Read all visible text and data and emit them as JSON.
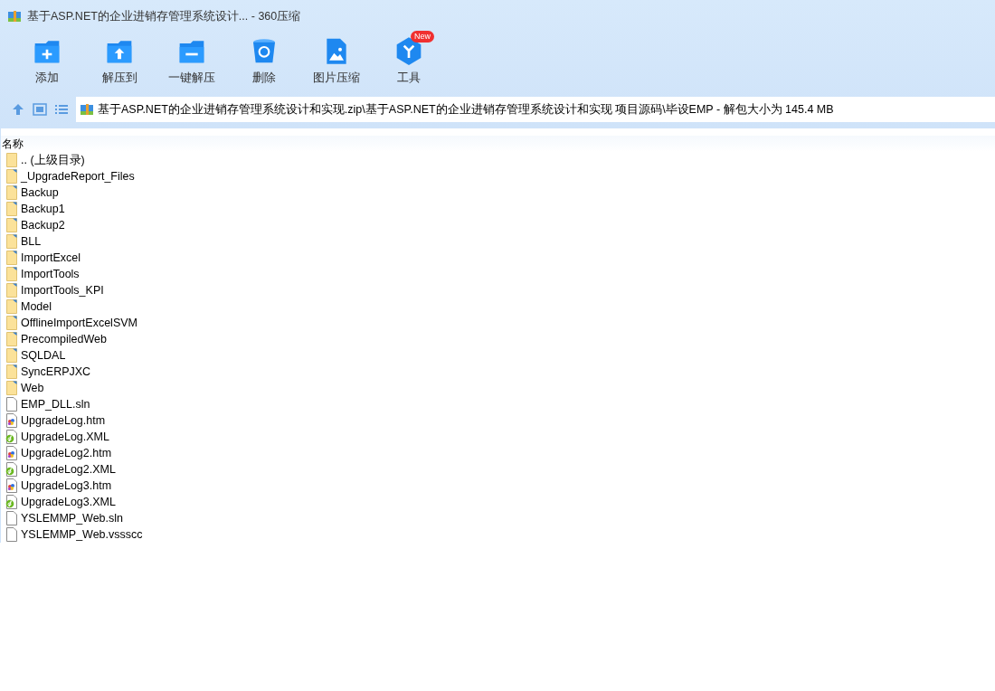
{
  "window": {
    "title": "基于ASP.NET的企业进销存管理系统设计... - 360压缩"
  },
  "toolbar": [
    {
      "kind": "add",
      "label": "添加"
    },
    {
      "kind": "extract-to",
      "label": "解压到"
    },
    {
      "kind": "extract",
      "label": "一键解压"
    },
    {
      "kind": "delete",
      "label": "删除"
    },
    {
      "kind": "image",
      "label": "图片压缩"
    },
    {
      "kind": "tools",
      "label": "工具",
      "badge": "New"
    }
  ],
  "address": {
    "path": "基于ASP.NET的企业进销存管理系统设计和实现.zip\\基于ASP.NET的企业进销存管理系统设计和实现 项目源码\\毕设EMP - 解包大小为 145.4 MB"
  },
  "table": {
    "columns": [
      "名称"
    ],
    "rows": [
      {
        "kind": "parent",
        "name": ".. (上级目录)"
      },
      {
        "kind": "folder",
        "name": "_UpgradeReport_Files"
      },
      {
        "kind": "folder",
        "name": "Backup"
      },
      {
        "kind": "folder",
        "name": "Backup1"
      },
      {
        "kind": "folder",
        "name": "Backup2"
      },
      {
        "kind": "folder",
        "name": "BLL"
      },
      {
        "kind": "folder",
        "name": "ImportExcel"
      },
      {
        "kind": "folder",
        "name": "ImportTools"
      },
      {
        "kind": "folder",
        "name": "ImportTools_KPI"
      },
      {
        "kind": "folder",
        "name": "Model"
      },
      {
        "kind": "folder",
        "name": "OfflineImportExcelSVM"
      },
      {
        "kind": "folder",
        "name": "PrecompiledWeb"
      },
      {
        "kind": "folder",
        "name": "SQLDAL"
      },
      {
        "kind": "folder",
        "name": "SyncERPJXC"
      },
      {
        "kind": "folder",
        "name": "Web"
      },
      {
        "kind": "file",
        "name": "EMP_DLL.sln"
      },
      {
        "kind": "htm",
        "name": "UpgradeLog.htm"
      },
      {
        "kind": "xml",
        "name": "UpgradeLog.XML"
      },
      {
        "kind": "htm",
        "name": "UpgradeLog2.htm"
      },
      {
        "kind": "xml",
        "name": "UpgradeLog2.XML"
      },
      {
        "kind": "htm",
        "name": "UpgradeLog3.htm"
      },
      {
        "kind": "xml",
        "name": "UpgradeLog3.XML"
      },
      {
        "kind": "file",
        "name": "YSLEMMP_Web.sln"
      },
      {
        "kind": "file",
        "name": "YSLEMMP_Web.vssscc"
      }
    ]
  }
}
